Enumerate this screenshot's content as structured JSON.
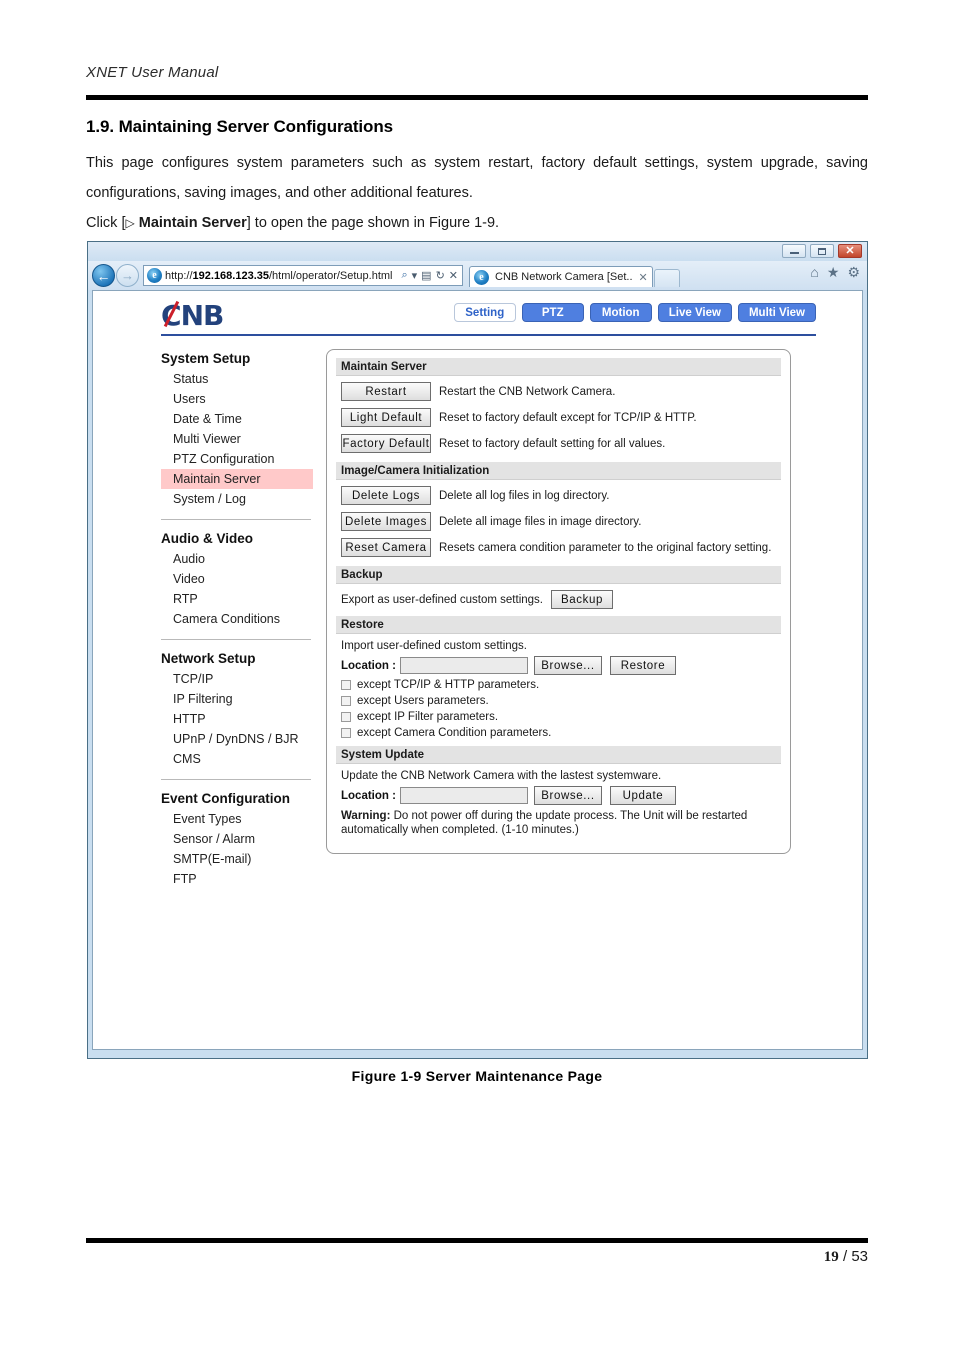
{
  "document": {
    "header_title": "XNET User Manual",
    "section_number_title": "1.9. Maintaining Server Configurations",
    "paragraph_1": "This page configures system parameters such as system restart, factory default settings, system upgrade, saving configurations, saving images, and other additional features.",
    "click_prefix": "Click [",
    "click_triangle": "▷",
    "click_bold": "Maintain Server",
    "click_suffix": "] to open the page shown in Figure 1-9.",
    "figure_caption": "Figure 1-9 Server Maintenance Page",
    "page_current": "19",
    "page_separator": "/",
    "page_total": "53"
  },
  "browser": {
    "window_buttons": {
      "minimize": "—",
      "maximize": "❐",
      "close": "✕"
    },
    "back_arrow": "←",
    "forward_arrow": "→",
    "address_scheme": "http://",
    "address_host": "192.168.123.35",
    "address_path": "/html/operator/Setup.html",
    "address_icons": {
      "search": "⌕",
      "compat": "▤",
      "refresh": "↻",
      "stop": "✕"
    },
    "tab_label": "CNB Network Camera [Set..",
    "tab_close": "✕",
    "toolbar_icons": {
      "home": "⌂",
      "favorites": "★",
      "tools": "⚙"
    }
  },
  "webapp": {
    "logo_text_left": "C",
    "logo_text_mid": "N",
    "logo_text_right": "B",
    "nav_tabs": [
      {
        "label": "Setting",
        "active": true
      },
      {
        "label": "PTZ",
        "active": false
      },
      {
        "label": "Motion",
        "active": false
      },
      {
        "label": "Live View",
        "active": false
      },
      {
        "label": "Multi View",
        "active": false
      }
    ],
    "sidebar": {
      "groups": [
        {
          "title": "System Setup",
          "items": [
            {
              "label": "Status",
              "active": false
            },
            {
              "label": "Users",
              "active": false
            },
            {
              "label": "Date & Time",
              "active": false
            },
            {
              "label": "Multi Viewer",
              "active": false
            },
            {
              "label": "PTZ Configuration",
              "active": false
            },
            {
              "label": "Maintain Server",
              "active": true
            },
            {
              "label": "System / Log",
              "active": false
            }
          ]
        },
        {
          "title": "Audio & Video",
          "items": [
            {
              "label": "Audio",
              "active": false
            },
            {
              "label": "Video",
              "active": false
            },
            {
              "label": "RTP",
              "active": false
            },
            {
              "label": "Camera Conditions",
              "active": false
            }
          ]
        },
        {
          "title": "Network Setup",
          "items": [
            {
              "label": "TCP/IP",
              "active": false
            },
            {
              "label": "IP Filtering",
              "active": false
            },
            {
              "label": "HTTP",
              "active": false
            },
            {
              "label": "UPnP / DynDNS / BJR",
              "active": false
            },
            {
              "label": "CMS",
              "active": false
            }
          ]
        },
        {
          "title": "Event Configuration",
          "items": [
            {
              "label": "Event Types",
              "active": false
            },
            {
              "label": "Sensor / Alarm",
              "active": false
            },
            {
              "label": "SMTP(E-mail)",
              "active": false
            },
            {
              "label": "FTP",
              "active": false
            }
          ]
        }
      ]
    },
    "sections": {
      "maintain_server": {
        "heading": "Maintain Server",
        "rows": [
          {
            "button": "Restart",
            "description": "Restart the CNB Network Camera."
          },
          {
            "button": "Light Default",
            "description": "Reset to factory default except for TCP/IP & HTTP."
          },
          {
            "button": "Factory Default",
            "description": "Reset to factory default setting for all values."
          }
        ]
      },
      "image_camera_init": {
        "heading": "Image/Camera Initialization",
        "rows": [
          {
            "button": "Delete Logs",
            "description": "Delete all log files in log directory."
          },
          {
            "button": "Delete Images",
            "description": "Delete all image files in image directory."
          },
          {
            "button": "Reset Camera",
            "description": "Resets camera condition parameter to the original factory setting."
          }
        ]
      },
      "backup": {
        "heading": "Backup",
        "text": "Export as user-defined custom settings.",
        "button": "Backup"
      },
      "restore": {
        "heading": "Restore",
        "text": "Import user-defined custom settings.",
        "location_label": "Location :",
        "location_value": "",
        "browse_button": "Browse...",
        "action_button": "Restore",
        "checkboxes": [
          {
            "label": "except TCP/IP & HTTP parameters.",
            "checked": false
          },
          {
            "label": "except Users parameters.",
            "checked": false
          },
          {
            "label": "except IP Filter parameters.",
            "checked": false
          },
          {
            "label": "except Camera Condition parameters.",
            "checked": false
          }
        ]
      },
      "system_update": {
        "heading": "System Update",
        "text": "Update the CNB Network Camera with the lastest systemware.",
        "location_label": "Location :",
        "location_value": "",
        "browse_button": "Browse...",
        "action_button": "Update",
        "warning_label": "Warning:",
        "warning_text": "Do not power off during the update process.  The Unit will be restarted automatically when completed. (1-10 minutes.)"
      }
    }
  },
  "colors": {
    "nav_blue": "#4f7fe0",
    "logo_navy": "#23427c",
    "logo_red": "#cc1f2a",
    "sidebar_active": "#ffc9c9",
    "section_bar": "#e3e3e3",
    "browser_frame": "#c9def0"
  }
}
